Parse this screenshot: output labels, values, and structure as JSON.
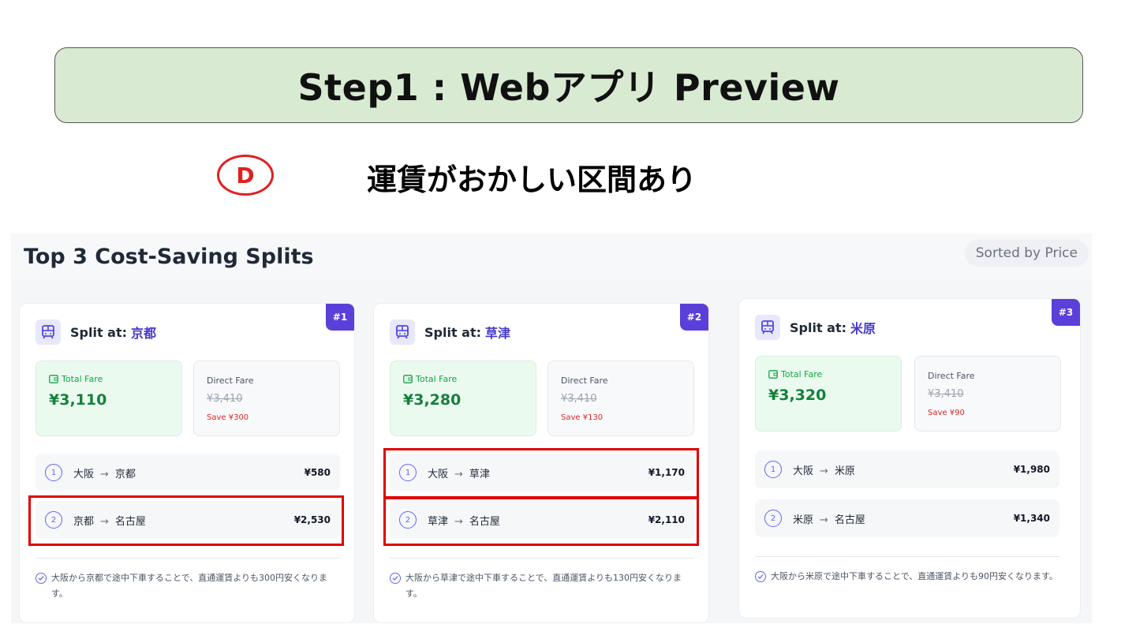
{
  "banner": {
    "title": "Step1 : Webアプリ Preview"
  },
  "annotation": {
    "badge": "D",
    "text": "運賃がおかしい区間あり"
  },
  "panel": {
    "title": "Top 3 Cost-Saving Splits",
    "sorted_label": "Sorted by Price"
  },
  "cards": [
    {
      "rank": "#1",
      "split_label": "Split at:",
      "split_station": "京都",
      "total_label": "Total Fare",
      "total_value": "¥3,110",
      "direct_label": "Direct Fare",
      "direct_value": "¥3,410",
      "save_value": "Save ¥300",
      "segments": [
        {
          "num": "1",
          "from": "大阪",
          "arrow": "→",
          "to": "京都",
          "price": "¥580"
        },
        {
          "num": "2",
          "from": "京都",
          "arrow": "→",
          "to": "名古屋",
          "price": "¥2,530"
        }
      ],
      "note": "大阪から京都で途中下車することで、直通運賃よりも300円安くなります。"
    },
    {
      "rank": "#2",
      "split_label": "Split at:",
      "split_station": "草津",
      "total_label": "Total Fare",
      "total_value": "¥3,280",
      "direct_label": "Direct Fare",
      "direct_value": "¥3,410",
      "save_value": "Save ¥130",
      "segments": [
        {
          "num": "1",
          "from": "大阪",
          "arrow": "→",
          "to": "草津",
          "price": "¥1,170"
        },
        {
          "num": "2",
          "from": "草津",
          "arrow": "→",
          "to": "名古屋",
          "price": "¥2,110"
        }
      ],
      "note": "大阪から草津で途中下車することで、直通運賃よりも130円安くなります。"
    },
    {
      "rank": "#3",
      "split_label": "Split at:",
      "split_station": "米原",
      "total_label": "Total Fare",
      "total_value": "¥3,320",
      "direct_label": "Direct Fare",
      "direct_value": "¥3,410",
      "save_value": "Save ¥90",
      "segments": [
        {
          "num": "1",
          "from": "大阪",
          "arrow": "→",
          "to": "米原",
          "price": "¥1,980"
        },
        {
          "num": "2",
          "from": "米原",
          "arrow": "→",
          "to": "名古屋",
          "price": "¥1,340"
        }
      ],
      "note": "大阪から米原で途中下車することで、直通運賃よりも90円安くなります。"
    }
  ],
  "colors": {
    "highlight": "#e00000",
    "accent": "#5b3fd9",
    "banner_bg": "#d9ead3",
    "total_green": "#15803d",
    "save_red": "#dc2626"
  },
  "icons": {
    "train": "train-icon",
    "wallet": "wallet-icon",
    "check": "check-circle-icon"
  }
}
